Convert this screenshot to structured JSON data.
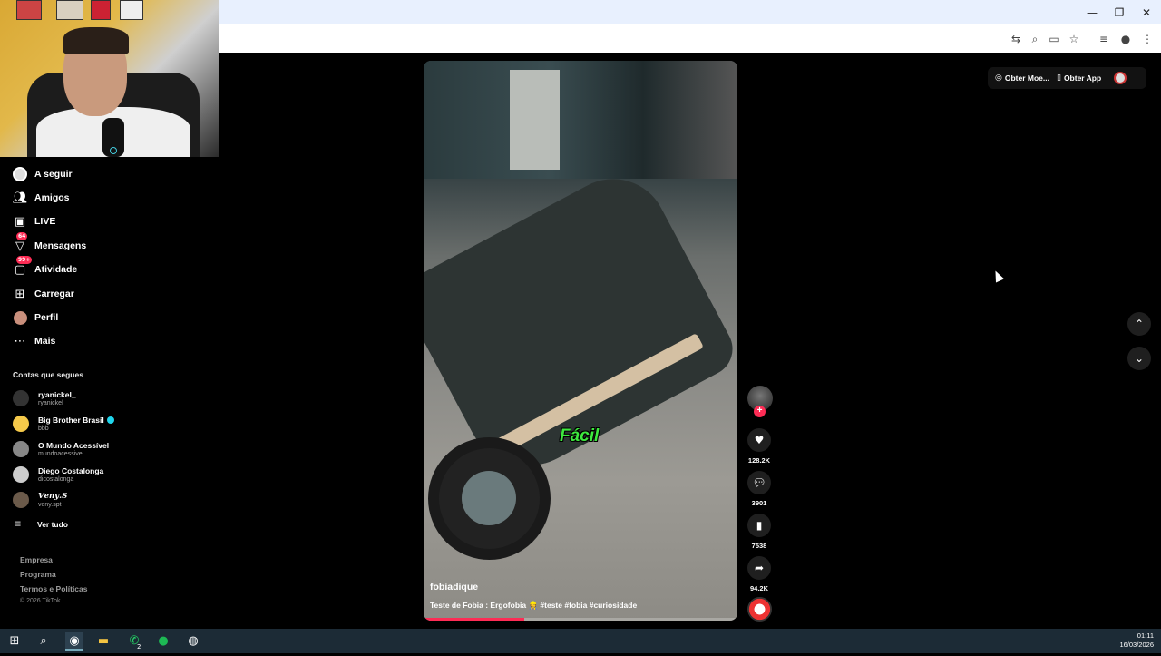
{
  "browser": {
    "window_controls": {
      "minimize": "—",
      "maximize": "❐",
      "close": "✕"
    },
    "toolbar_icons": [
      "translate-icon",
      "zoom-icon",
      "cast-icon",
      "star-icon",
      "media-icon",
      "profile-icon",
      "menu-icon"
    ]
  },
  "sidebar": {
    "items": [
      {
        "label": "A seguir",
        "icon": "avatar-icon"
      },
      {
        "label": "Amigos",
        "icon": "friends-icon"
      },
      {
        "label": "LIVE",
        "icon": "live-icon"
      },
      {
        "label": "Mensagens",
        "icon": "messages-icon",
        "badge": "64"
      },
      {
        "label": "Atividade",
        "icon": "activity-icon",
        "badge": "99+"
      },
      {
        "label": "Carregar",
        "icon": "upload-icon"
      },
      {
        "label": "Perfil",
        "icon": "profile-icon"
      },
      {
        "label": "Mais",
        "icon": "more-icon"
      }
    ],
    "following_title": "Contas que segues",
    "accounts": [
      {
        "name": "ryanickel_",
        "handle": "ryanickel_",
        "verified": false
      },
      {
        "name": "Big Brother Brasil",
        "handle": "bbb",
        "verified": true
      },
      {
        "name": "O Mundo Acessível",
        "handle": "mundoacessivel",
        "verified": false
      },
      {
        "name": "Diego Costalonga",
        "handle": "dicostalonga",
        "verified": false
      },
      {
        "name": "𝑽𝒆𝒏𝒚.𝑺",
        "handle": "veny.spt",
        "verified": false
      }
    ],
    "see_all": "Ver tudo",
    "footer": {
      "company": "Empresa",
      "program": "Programa",
      "terms": "Termos e Políticas",
      "copyright": "© 2026 TikTok"
    }
  },
  "video": {
    "caption_overlay": "Fácil",
    "author": "fobiadique",
    "description": "Teste de Fobia : Ergofobia 👷 #teste #fobia #curiosidade",
    "progress": 0.32
  },
  "actions": {
    "likes": "128.2K",
    "comments": "3901",
    "saves": "7538",
    "shares": "94.2K"
  },
  "topbar": {
    "coins": "Obter Moe...",
    "app": "Obter App"
  },
  "taskbar": {
    "time": "01:11",
    "date": "16/03/2026",
    "whatsapp_badge": "2"
  }
}
